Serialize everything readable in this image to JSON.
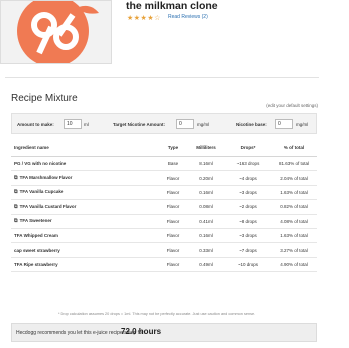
{
  "product": {
    "title": "the milkman clone",
    "stars": "★★★★☆",
    "reviews": "Read Reviews (2)",
    "logo_color": "#f07a53"
  },
  "recipe": {
    "section_title": "Recipe Mixture",
    "edit_link": "(edit your default settings)",
    "amount_label": "Amount to make:",
    "amount_value": "10",
    "amount_unit": "ml",
    "nicotine_label": "Target Nicotine Amount:",
    "nicotine_value": "0",
    "nicotine_unit": "mg/ml",
    "base_label": "Nicotine base:",
    "base_value": "0",
    "base_unit": "mg/ml",
    "columns": [
      "Ingredient name",
      "Type",
      "Milliliters",
      "Drops*",
      "% of total"
    ],
    "rows": [
      {
        "name": "PG / VG with no nicotine",
        "link": false,
        "type": "Base",
        "ml": "8.16ml",
        "drops": "~163 drops",
        "pct": "81.63% of total"
      },
      {
        "name": "TFA Marshmallow Flavor",
        "link": true,
        "type": "Flavor",
        "ml": "0.20ml",
        "drops": "~4 drops",
        "pct": "2.04% of total"
      },
      {
        "name": "TFA Vanilla Cupcake",
        "link": true,
        "type": "Flavor",
        "ml": "0.16ml",
        "drops": "~3 drops",
        "pct": "1.63% of total"
      },
      {
        "name": "TFA Vanilla Custard Flavor",
        "link": true,
        "type": "Flavor",
        "ml": "0.08ml",
        "drops": "~2 drops",
        "pct": "0.82% of total"
      },
      {
        "name": "TFA Sweetener",
        "link": true,
        "type": "Flavor",
        "ml": "0.41ml",
        "drops": "~8 drops",
        "pct": "4.08% of total"
      },
      {
        "name": "TFA Whipped Cream",
        "link": false,
        "type": "Flavor",
        "ml": "0.16ml",
        "drops": "~3 drops",
        "pct": "1.63% of total"
      },
      {
        "name": "cap sweet strawberry",
        "link": false,
        "type": "Flavor",
        "ml": "0.33ml",
        "drops": "~7 drops",
        "pct": "3.27% of total"
      },
      {
        "name": "TFA Ripe strawberry",
        "link": false,
        "type": "Flavor",
        "ml": "0.49ml",
        "drops": "~10 drops",
        "pct": "4.90% of total"
      }
    ],
    "note": "* Drop calculation assumes 20 drops = 1ml. This may not be perfectly accurate. Just use caution and common sense.",
    "steep_text": "Hecdogg recommends you let this e-juice recipe steep for:",
    "steep_hours": "72.0 hours"
  }
}
